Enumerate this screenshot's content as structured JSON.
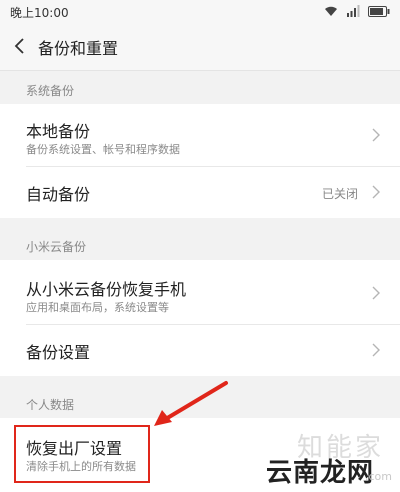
{
  "status_bar": {
    "time": "晚上10:00"
  },
  "header": {
    "title": "备份和重置"
  },
  "sections": {
    "system_backup": {
      "label": "系统备份",
      "local_backup": {
        "title": "本地备份",
        "subtitle": "备份系统设置、帐号和程序数据"
      },
      "auto_backup": {
        "title": "自动备份",
        "value": "已关闭"
      }
    },
    "cloud_backup": {
      "label": "小米云备份",
      "restore_from_cloud": {
        "title": "从小米云备份恢复手机",
        "subtitle": "应用和桌面布局，系统设置等"
      },
      "backup_settings": {
        "title": "备份设置"
      }
    },
    "personal_data": {
      "label": "个人数据",
      "factory_reset": {
        "title": "恢复出厂设置",
        "subtitle": "清除手机上的所有数据"
      }
    }
  },
  "watermark": {
    "line1": "知能家",
    "line2": "云南龙网",
    "url": ".com"
  },
  "colors": {
    "annotation": "#e0261a"
  }
}
